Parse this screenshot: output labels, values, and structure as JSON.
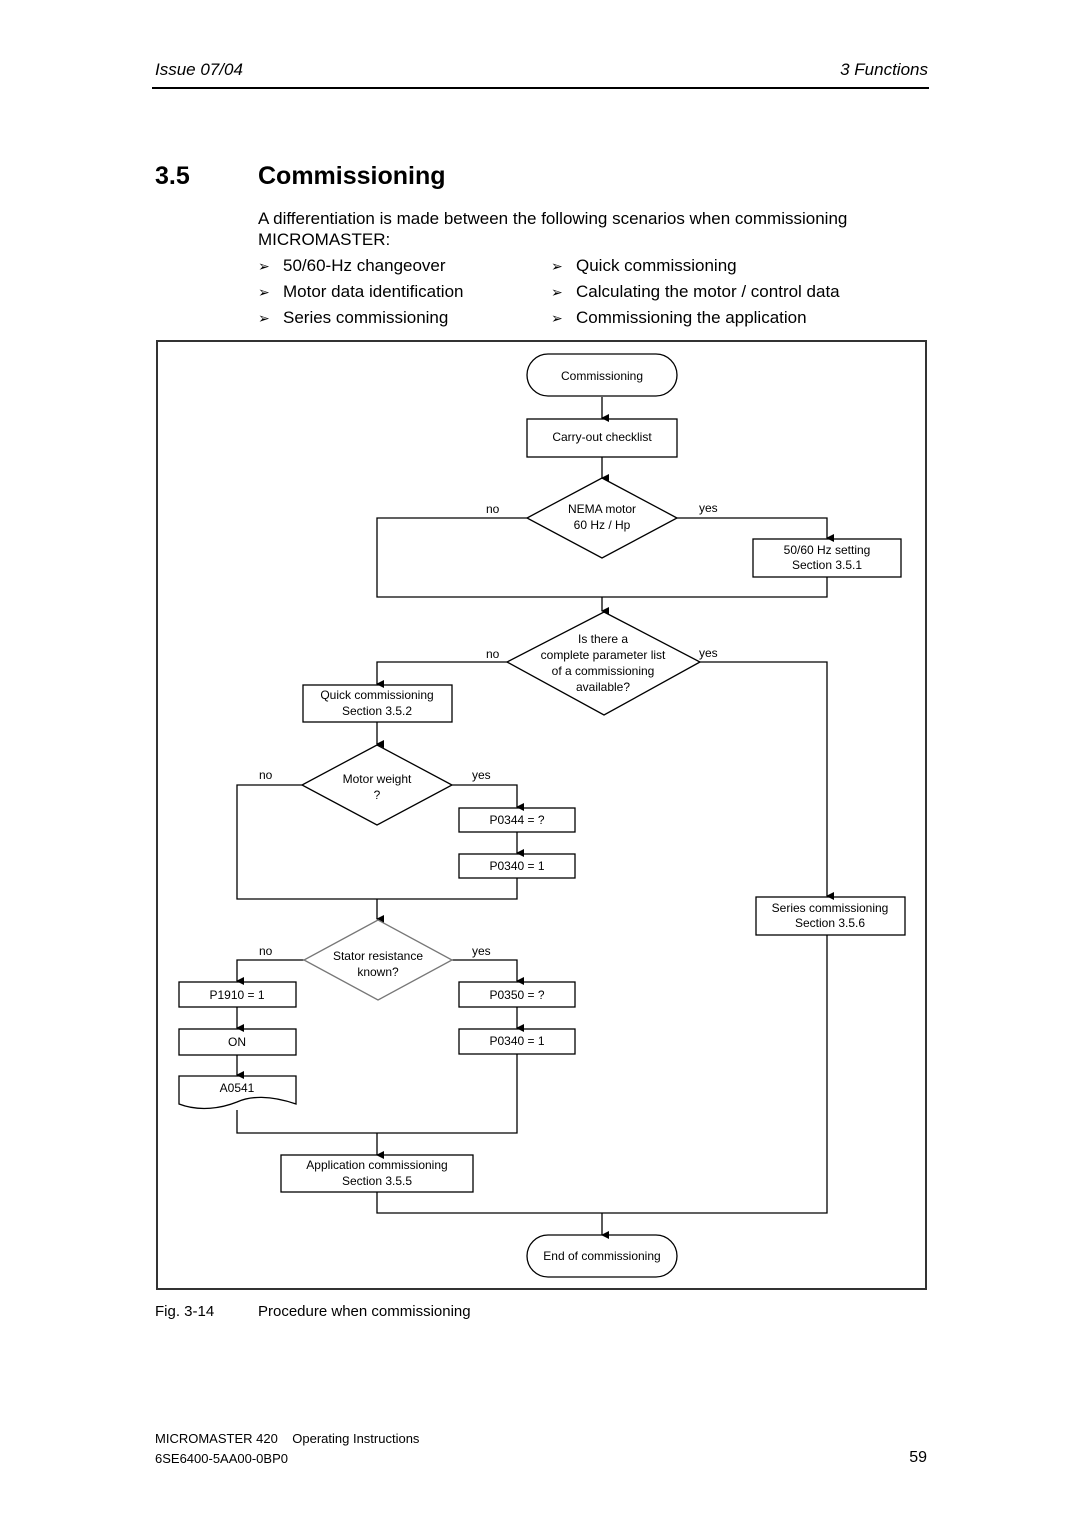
{
  "header": {
    "issue": "Issue 07/04",
    "chapter": "3  Functions"
  },
  "section": {
    "number": "3.5",
    "title": "Commissioning",
    "intro": "A differentiation is made between the following scenarios when commissioning MICROMASTER:",
    "bullet_marker": "➢",
    "bullets_left": [
      "50/60-Hz changeover",
      "Motor data identification",
      "Series commissioning"
    ],
    "bullets_right": [
      "Quick commissioning",
      "Calculating the motor / control data",
      "Commissioning the application"
    ]
  },
  "flowchart": {
    "start": "Commissioning",
    "checklist": "Carry-out checklist",
    "nema_decision": [
      "NEMA motor",
      "60 Hz / Hp"
    ],
    "hz_setting": [
      "50/60 Hz setting",
      "Section 3.5.1"
    ],
    "param_decision": [
      "Is there a",
      "complete parameter list",
      "of a commissioning",
      "available?"
    ],
    "quick_comm": [
      "Quick commissioning",
      "Section 3.5.2"
    ],
    "weight_decision": [
      "Motor weight",
      "?"
    ],
    "p0344": "P0344 = ?",
    "p0340_a": "P0340 = 1",
    "stator_decision": [
      "Stator resistance",
      "known?"
    ],
    "p1910": "P1910 = 1",
    "on": "ON",
    "a0541": "A0541",
    "p0350": "P0350 = ?",
    "p0340_b": "P0340 = 1",
    "series_comm": [
      "Series commissioning",
      "Section 3.5.6"
    ],
    "app_comm": [
      "Application commissioning",
      "Section 3.5.5"
    ],
    "end": "End of commissioning",
    "no": "no",
    "yes": "yes"
  },
  "figure": {
    "number": "Fig. 3-14",
    "caption": "Procedure when commissioning"
  },
  "footer": {
    "product": "MICROMASTER 420    Operating Instructions",
    "order_no": "6SE6400-5AA00-0BP0",
    "page": "59"
  }
}
